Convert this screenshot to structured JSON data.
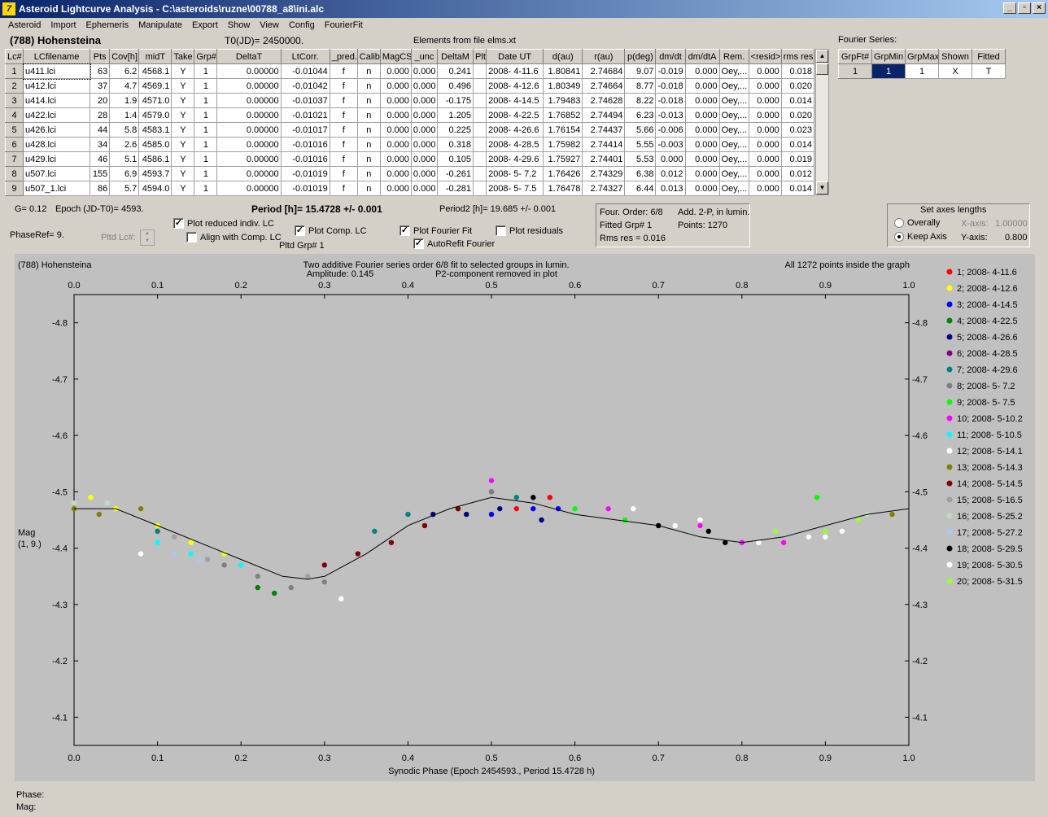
{
  "window": {
    "title": "Asteroid Lightcurve Analysis - C:\\asteroids\\ruzne\\00788_a8\\ini.alc",
    "icon": "app-icon"
  },
  "menu": [
    "Asteroid",
    "Import",
    "Ephemeris",
    "Manipulate",
    "Export",
    "Show",
    "View",
    "Config",
    "FourierFit"
  ],
  "header": {
    "asteroid": "(788) Hohensteina",
    "t0": "T0(JD)= 2450000.",
    "elements": "Elements from file elms.xt",
    "fourier_series": "Fourier Series:"
  },
  "lc_table": {
    "columns": [
      "Lc#",
      "LCfilename",
      "Pts",
      "Cov[h]",
      "midT",
      "Take",
      "Grp#",
      "DeltaT",
      "LtCorr.",
      "_pred.",
      "Calib.",
      "MagCS",
      "_unc",
      "DeltaM",
      "Plt",
      "Date UT",
      "d(au)",
      "r(au)",
      "p(deg)",
      "dm/dt",
      "dm/dtA",
      "Rem.",
      "<resid>",
      "rms res"
    ],
    "rows": [
      [
        "1",
        "u411.lci",
        "63",
        "6.2",
        "4568.1",
        "Y",
        "1",
        "0.00000",
        "-0.01044",
        "f",
        "n",
        "0.000",
        "0.000",
        "0.241",
        "",
        "2008- 4-11.6",
        "1.80841",
        "2.74684",
        "9.07",
        "-0.019",
        "0.000",
        "Oey,...",
        "0.000",
        "0.018"
      ],
      [
        "2",
        "u412.lci",
        "37",
        "4.7",
        "4569.1",
        "Y",
        "1",
        "0.00000",
        "-0.01042",
        "f",
        "n",
        "0.000",
        "0.000",
        "0.496",
        "",
        "2008- 4-12.6",
        "1.80349",
        "2.74664",
        "8.77",
        "-0.018",
        "0.000",
        "Oey,...",
        "0.000",
        "0.020"
      ],
      [
        "3",
        "u414.lci",
        "20",
        "1.9",
        "4571.0",
        "Y",
        "1",
        "0.00000",
        "-0.01037",
        "f",
        "n",
        "0.000",
        "0.000",
        "-0.175",
        "",
        "2008- 4-14.5",
        "1.79483",
        "2.74628",
        "8.22",
        "-0.018",
        "0.000",
        "Oey,...",
        "0.000",
        "0.014"
      ],
      [
        "4",
        "u422.lci",
        "28",
        "1.4",
        "4579.0",
        "Y",
        "1",
        "0.00000",
        "-0.01021",
        "f",
        "n",
        "0.000",
        "0.000",
        "1.205",
        "",
        "2008- 4-22.5",
        "1.76852",
        "2.74494",
        "6.23",
        "-0.013",
        "0.000",
        "Oey,...",
        "0.000",
        "0.020"
      ],
      [
        "5",
        "u426.lci",
        "44",
        "5.8",
        "4583.1",
        "Y",
        "1",
        "0.00000",
        "-0.01017",
        "f",
        "n",
        "0.000",
        "0.000",
        "0.225",
        "",
        "2008- 4-26.6",
        "1.76154",
        "2.74437",
        "5.66",
        "-0.006",
        "0.000",
        "Oey,...",
        "0.000",
        "0.023"
      ],
      [
        "6",
        "u428.lci",
        "34",
        "2.6",
        "4585.0",
        "Y",
        "1",
        "0.00000",
        "-0.01016",
        "f",
        "n",
        "0.000",
        "0.000",
        "0.318",
        "",
        "2008- 4-28.5",
        "1.75982",
        "2.74414",
        "5.55",
        "-0.003",
        "0.000",
        "Oey,...",
        "0.000",
        "0.014"
      ],
      [
        "7",
        "u429.lci",
        "46",
        "5.1",
        "4586.1",
        "Y",
        "1",
        "0.00000",
        "-0.01016",
        "f",
        "n",
        "0.000",
        "0.000",
        "0.105",
        "",
        "2008- 4-29.6",
        "1.75927",
        "2.74401",
        "5.53",
        "0.000",
        "0.000",
        "Oey,...",
        "0.000",
        "0.019"
      ],
      [
        "8",
        "u507.lci",
        "155",
        "6.9",
        "4593.7",
        "Y",
        "1",
        "0.00000",
        "-0.01019",
        "f",
        "n",
        "0.000",
        "0.000",
        "-0.261",
        "",
        "2008- 5- 7.2",
        "1.76426",
        "2.74329",
        "6.38",
        "0.012",
        "0.000",
        "Oey,...",
        "0.000",
        "0.012"
      ],
      [
        "9",
        "u507_1.lci",
        "86",
        "5.7",
        "4594.0",
        "Y",
        "1",
        "0.00000",
        "-0.01019",
        "f",
        "n",
        "0.000",
        "0.000",
        "-0.281",
        "",
        "2008- 5- 7.5",
        "1.76478",
        "2.74327",
        "6.44",
        "0.013",
        "0.000",
        "Oey,...",
        "0.000",
        "0.014"
      ]
    ]
  },
  "fourier_table": {
    "columns": [
      "GrpFt#",
      "GrpMin",
      "GrpMax",
      "Shown",
      "Fitted"
    ],
    "row": [
      "1",
      "1",
      "1",
      "X",
      "T"
    ]
  },
  "controls": {
    "g": "G= 0.12",
    "epoch": "Epoch (JD-T0)= 4593.",
    "period": "Period [h]= 15.4728 +/- 0.001",
    "period2": "Period2 [h]= 19.685 +/- 0.001",
    "phaseref": "PhaseRef= 9.",
    "pltd_lc": "Pltd Lc#:",
    "pltd_grp": "Pltd Grp# 1",
    "cb_reduced": "Plot reduced indiv. LC",
    "cb_align": "Align with Comp. LC",
    "cb_comp": "Plot Comp. LC",
    "cb_fourier": "Plot Fourier Fit",
    "cb_autorefit": "AutoRefit Fourier",
    "cb_resid": "Plot residuals",
    "stats": {
      "order": "Four. Order:  6/8",
      "addp": "Add. 2-P, in lumin.",
      "fitted": "Fitted Grp# 1",
      "points": "Points: 1270",
      "rms": "Rms res     = 0.016"
    },
    "axes": {
      "title": "Set axes lengths",
      "overally": "Overally",
      "keep": "Keep Axis",
      "xlabel": "X-axis:",
      "xval": "1.00000",
      "ylabel": "Y-axis:",
      "yval": "0.800"
    },
    "check": "✓"
  },
  "status": {
    "phase": "Phase:",
    "mag": "Mag:"
  },
  "chart_data": {
    "type": "scatter",
    "title_left": "(788) Hohensteina",
    "title_center": "Two additive Fourier series order 6/8 fit to selected groups in lumin.",
    "subtitle_amp": "Amplitude: 0.145",
    "subtitle_p2": "P2-component removed in plot",
    "title_right": "All 1272 points inside the graph",
    "xlabel": "Synodic Phase (Epoch 2454593., Period 15.4728 h)",
    "ylabel": "Mag",
    "ylabel2": "(1, 9.)",
    "xlim": [
      0,
      1
    ],
    "ylim": [
      -4.85,
      -4.05
    ],
    "x_ticks": [
      "0.0",
      "0.1",
      "0.2",
      "0.3",
      "0.4",
      "0.5",
      "0.6",
      "0.7",
      "0.8",
      "0.9",
      "1.0"
    ],
    "y_ticks": [
      "-4.8",
      "-4.7",
      "-4.6",
      "-4.5",
      "-4.4",
      "-4.3",
      "-4.2",
      "-4.1"
    ],
    "background": "#c0c0c0",
    "legend": [
      {
        "label": "1; 2008- 4-11.6",
        "color": "#ff0000",
        "x": [
          0.53,
          0.57
        ],
        "y": [
          -4.47,
          -4.49
        ]
      },
      {
        "label": "2; 2008- 4-12.6",
        "color": "#ffff00",
        "x": [
          0.02,
          0.05,
          0.1,
          0.14,
          0.18
        ],
        "y": [
          -4.49,
          -4.47,
          -4.44,
          -4.41,
          -4.39
        ]
      },
      {
        "label": "3; 2008- 4-14.5",
        "color": "#0000ff",
        "x": [
          0.5,
          0.55,
          0.58
        ],
        "y": [
          -4.46,
          -4.47,
          -4.47
        ]
      },
      {
        "label": "4; 2008- 4-22.5",
        "color": "#008000",
        "x": [
          0.22,
          0.24
        ],
        "y": [
          -4.33,
          -4.32
        ]
      },
      {
        "label": "5; 2008- 4-26.6",
        "color": "#000080",
        "x": [
          0.43,
          0.47,
          0.51,
          0.56
        ],
        "y": [
          -4.46,
          -4.46,
          -4.47,
          -4.45
        ]
      },
      {
        "label": "6; 2008- 4-28.5",
        "color": "#800080",
        "x": [
          0.5
        ],
        "y": [
          -4.5
        ]
      },
      {
        "label": "7; 2008- 4-29.6",
        "color": "#008080",
        "x": [
          0.1,
          0.36,
          0.4,
          0.53
        ],
        "y": [
          -4.43,
          -4.43,
          -4.46,
          -4.49
        ]
      },
      {
        "label": "8; 2008- 5- 7.2",
        "color": "#808080",
        "x": [
          0.18,
          0.22,
          0.26,
          0.3,
          0.5
        ],
        "y": [
          -4.37,
          -4.35,
          -4.33,
          -4.34,
          -4.5
        ]
      },
      {
        "label": "9; 2008- 5- 7.5",
        "color": "#00ff00",
        "x": [
          0.46,
          0.6,
          0.66,
          0.89
        ],
        "y": [
          -4.47,
          -4.47,
          -4.45,
          -4.49
        ]
      },
      {
        "label": "10; 2008- 5-10.2",
        "color": "#ff00ff",
        "x": [
          0.5,
          0.64,
          0.75,
          0.8,
          0.85
        ],
        "y": [
          -4.52,
          -4.47,
          -4.44,
          -4.41,
          -4.41
        ]
      },
      {
        "label": "11; 2008- 5-10.5",
        "color": "#00ffff",
        "x": [
          0.1,
          0.14,
          0.2
        ],
        "y": [
          -4.41,
          -4.39,
          -4.37
        ]
      },
      {
        "label": "12; 2008- 5-14.1",
        "color": "#ffffff",
        "x": [
          0.08,
          0.32,
          0.67,
          0.75,
          0.9
        ],
        "y": [
          -4.39,
          -4.31,
          -4.47,
          -4.45,
          -4.42
        ]
      },
      {
        "label": "13; 2008- 5-14.3",
        "color": "#808000",
        "x": [
          0.0,
          0.03,
          0.08,
          0.98
        ],
        "y": [
          -4.47,
          -4.46,
          -4.47,
          -4.46
        ]
      },
      {
        "label": "14; 2008- 5-14.5",
        "color": "#800000",
        "x": [
          0.3,
          0.34,
          0.38,
          0.42,
          0.46
        ],
        "y": [
          -4.37,
          -4.39,
          -4.41,
          -4.44,
          -4.47
        ]
      },
      {
        "label": "15; 2008- 5-16.5",
        "color": "#a0a0a0",
        "x": [
          0.12,
          0.16,
          0.28
        ],
        "y": [
          -4.42,
          -4.38,
          -4.35
        ]
      },
      {
        "label": "16; 2008- 5-25.2",
        "color": "#c0dcc0",
        "x": [
          0.0,
          0.04,
          0.95
        ],
        "y": [
          -4.48,
          -4.48,
          -4.46
        ]
      },
      {
        "label": "17; 2008- 5-27.2",
        "color": "#a6caf0",
        "x": [
          0.12,
          0.15
        ],
        "y": [
          -4.39,
          -4.38
        ]
      },
      {
        "label": "18; 2008- 5-29.5",
        "color": "#000000",
        "x": [
          0.55,
          0.7,
          0.76,
          0.78
        ],
        "y": [
          -4.49,
          -4.44,
          -4.43,
          -4.41
        ]
      },
      {
        "label": "19; 2008- 5-30.5",
        "color": "#ffffff",
        "x": [
          0.72,
          0.82,
          0.88,
          0.92
        ],
        "y": [
          -4.44,
          -4.41,
          -4.42,
          -4.43
        ]
      },
      {
        "label": "20; 2008- 5-31.5",
        "color": "#99ff33",
        "x": [
          0.84,
          0.9,
          0.94
        ],
        "y": [
          -4.43,
          -4.43,
          -4.45
        ]
      }
    ],
    "fit_curve": {
      "x": [
        0.0,
        0.05,
        0.1,
        0.15,
        0.2,
        0.25,
        0.28,
        0.3,
        0.35,
        0.4,
        0.45,
        0.5,
        0.55,
        0.6,
        0.65,
        0.7,
        0.75,
        0.8,
        0.85,
        0.9,
        0.95,
        1.0
      ],
      "y": [
        -4.47,
        -4.47,
        -4.44,
        -4.41,
        -4.38,
        -4.35,
        -4.345,
        -4.35,
        -4.39,
        -4.44,
        -4.47,
        -4.49,
        -4.48,
        -4.46,
        -4.45,
        -4.44,
        -4.42,
        -4.41,
        -4.42,
        -4.44,
        -4.46,
        -4.47
      ]
    }
  }
}
